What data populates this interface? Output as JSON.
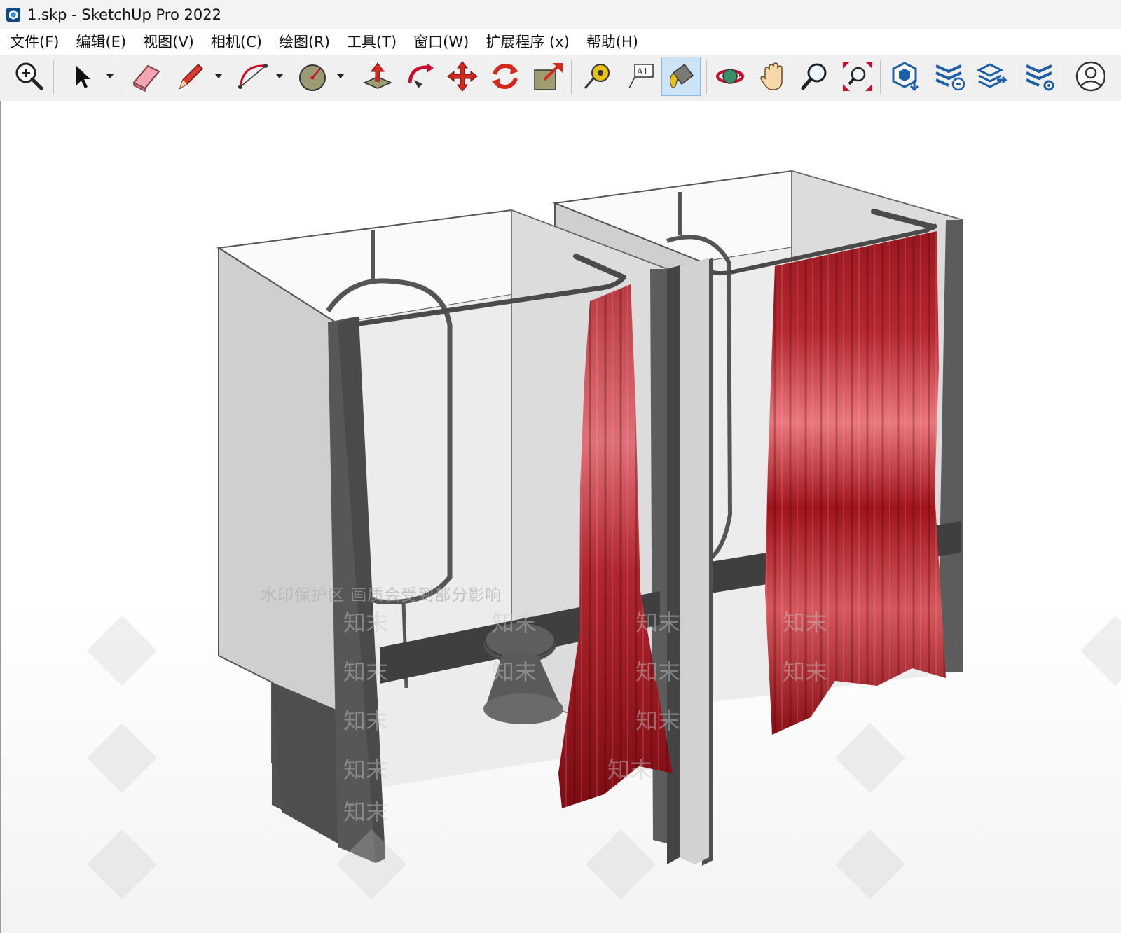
{
  "window": {
    "title": "1.skp - SketchUp Pro 2022",
    "app_icon": "sketchup-logo-icon"
  },
  "menu": [
    {
      "label": "文件(F)"
    },
    {
      "label": "编辑(E)"
    },
    {
      "label": "视图(V)"
    },
    {
      "label": "相机(C)"
    },
    {
      "label": "绘图(R)"
    },
    {
      "label": "工具(T)"
    },
    {
      "label": "窗口(W)"
    },
    {
      "label": "扩展程序 (x)"
    },
    {
      "label": "帮助(H)"
    }
  ],
  "toolbar": {
    "tools": [
      {
        "icon": "zoom-extents-icon",
        "dropdown": false
      },
      {
        "icon": "select-arrow-icon",
        "dropdown": true
      },
      {
        "icon": "eraser-icon",
        "dropdown": false
      },
      {
        "icon": "pencil-line-icon",
        "dropdown": true
      },
      {
        "icon": "arc-icon",
        "dropdown": true
      },
      {
        "icon": "circle-icon",
        "dropdown": true
      },
      {
        "icon": "push-pull-icon",
        "dropdown": false
      },
      {
        "icon": "follow-me-icon",
        "dropdown": false
      },
      {
        "icon": "move-icon",
        "dropdown": false
      },
      {
        "icon": "rotate-icon",
        "dropdown": false
      },
      {
        "icon": "scale-icon",
        "dropdown": false
      },
      {
        "icon": "tape-measure-icon",
        "dropdown": false
      },
      {
        "icon": "text-label-icon",
        "dropdown": false
      },
      {
        "icon": "paint-bucket-icon",
        "dropdown": false,
        "active": true
      },
      {
        "icon": "orbit-icon",
        "dropdown": false
      },
      {
        "icon": "pan-hand-icon",
        "dropdown": false
      },
      {
        "icon": "zoom-icon",
        "dropdown": false
      },
      {
        "icon": "zoom-window-icon",
        "dropdown": false
      },
      {
        "icon": "warehouse-icon",
        "dropdown": false
      },
      {
        "icon": "extension-warehouse-icon",
        "dropdown": false
      },
      {
        "icon": "layout-send-icon",
        "dropdown": false
      },
      {
        "icon": "extension-manager-icon",
        "dropdown": false
      },
      {
        "icon": "user-account-icon",
        "dropdown": false
      }
    ]
  },
  "viewport": {
    "watermark_text": "水印保护区  画质会受到部分影响",
    "watermark_logo": "知末"
  },
  "colors": {
    "panel_face": "#cfcfcf",
    "panel_edge": "#5a5a5a",
    "inner_wall": "#ebebeb",
    "rod": "#4a4a4a",
    "curtain_dark": "#8a0f16",
    "curtain_light": "#e0666c",
    "active_tool_bg": "#cde4f7"
  }
}
